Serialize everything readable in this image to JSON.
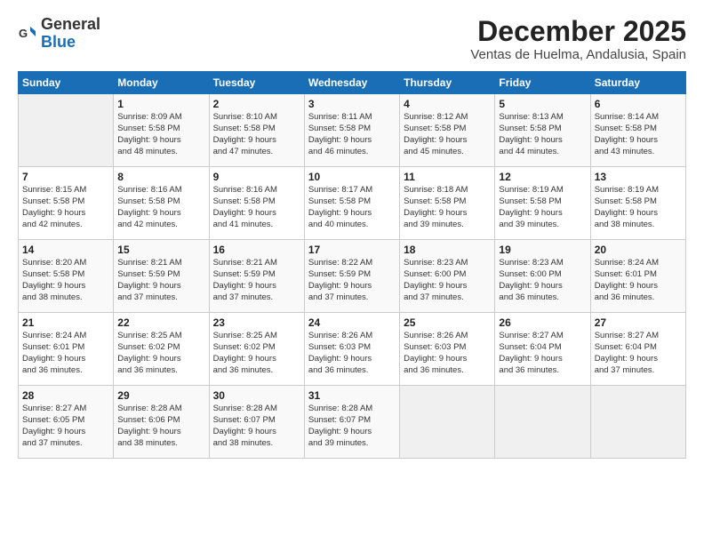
{
  "header": {
    "logo_general": "General",
    "logo_blue": "Blue",
    "month_title": "December 2025",
    "location": "Ventas de Huelma, Andalusia, Spain"
  },
  "days_of_week": [
    "Sunday",
    "Monday",
    "Tuesday",
    "Wednesday",
    "Thursday",
    "Friday",
    "Saturday"
  ],
  "weeks": [
    [
      {
        "num": "",
        "detail": ""
      },
      {
        "num": "1",
        "detail": "Sunrise: 8:09 AM\nSunset: 5:58 PM\nDaylight: 9 hours\nand 48 minutes."
      },
      {
        "num": "2",
        "detail": "Sunrise: 8:10 AM\nSunset: 5:58 PM\nDaylight: 9 hours\nand 47 minutes."
      },
      {
        "num": "3",
        "detail": "Sunrise: 8:11 AM\nSunset: 5:58 PM\nDaylight: 9 hours\nand 46 minutes."
      },
      {
        "num": "4",
        "detail": "Sunrise: 8:12 AM\nSunset: 5:58 PM\nDaylight: 9 hours\nand 45 minutes."
      },
      {
        "num": "5",
        "detail": "Sunrise: 8:13 AM\nSunset: 5:58 PM\nDaylight: 9 hours\nand 44 minutes."
      },
      {
        "num": "6",
        "detail": "Sunrise: 8:14 AM\nSunset: 5:58 PM\nDaylight: 9 hours\nand 43 minutes."
      }
    ],
    [
      {
        "num": "7",
        "detail": "Sunrise: 8:15 AM\nSunset: 5:58 PM\nDaylight: 9 hours\nand 42 minutes."
      },
      {
        "num": "8",
        "detail": "Sunrise: 8:16 AM\nSunset: 5:58 PM\nDaylight: 9 hours\nand 42 minutes."
      },
      {
        "num": "9",
        "detail": "Sunrise: 8:16 AM\nSunset: 5:58 PM\nDaylight: 9 hours\nand 41 minutes."
      },
      {
        "num": "10",
        "detail": "Sunrise: 8:17 AM\nSunset: 5:58 PM\nDaylight: 9 hours\nand 40 minutes."
      },
      {
        "num": "11",
        "detail": "Sunrise: 8:18 AM\nSunset: 5:58 PM\nDaylight: 9 hours\nand 39 minutes."
      },
      {
        "num": "12",
        "detail": "Sunrise: 8:19 AM\nSunset: 5:58 PM\nDaylight: 9 hours\nand 39 minutes."
      },
      {
        "num": "13",
        "detail": "Sunrise: 8:19 AM\nSunset: 5:58 PM\nDaylight: 9 hours\nand 38 minutes."
      }
    ],
    [
      {
        "num": "14",
        "detail": "Sunrise: 8:20 AM\nSunset: 5:58 PM\nDaylight: 9 hours\nand 38 minutes."
      },
      {
        "num": "15",
        "detail": "Sunrise: 8:21 AM\nSunset: 5:59 PM\nDaylight: 9 hours\nand 37 minutes."
      },
      {
        "num": "16",
        "detail": "Sunrise: 8:21 AM\nSunset: 5:59 PM\nDaylight: 9 hours\nand 37 minutes."
      },
      {
        "num": "17",
        "detail": "Sunrise: 8:22 AM\nSunset: 5:59 PM\nDaylight: 9 hours\nand 37 minutes."
      },
      {
        "num": "18",
        "detail": "Sunrise: 8:23 AM\nSunset: 6:00 PM\nDaylight: 9 hours\nand 37 minutes."
      },
      {
        "num": "19",
        "detail": "Sunrise: 8:23 AM\nSunset: 6:00 PM\nDaylight: 9 hours\nand 36 minutes."
      },
      {
        "num": "20",
        "detail": "Sunrise: 8:24 AM\nSunset: 6:01 PM\nDaylight: 9 hours\nand 36 minutes."
      }
    ],
    [
      {
        "num": "21",
        "detail": "Sunrise: 8:24 AM\nSunset: 6:01 PM\nDaylight: 9 hours\nand 36 minutes."
      },
      {
        "num": "22",
        "detail": "Sunrise: 8:25 AM\nSunset: 6:02 PM\nDaylight: 9 hours\nand 36 minutes."
      },
      {
        "num": "23",
        "detail": "Sunrise: 8:25 AM\nSunset: 6:02 PM\nDaylight: 9 hours\nand 36 minutes."
      },
      {
        "num": "24",
        "detail": "Sunrise: 8:26 AM\nSunset: 6:03 PM\nDaylight: 9 hours\nand 36 minutes."
      },
      {
        "num": "25",
        "detail": "Sunrise: 8:26 AM\nSunset: 6:03 PM\nDaylight: 9 hours\nand 36 minutes."
      },
      {
        "num": "26",
        "detail": "Sunrise: 8:27 AM\nSunset: 6:04 PM\nDaylight: 9 hours\nand 36 minutes."
      },
      {
        "num": "27",
        "detail": "Sunrise: 8:27 AM\nSunset: 6:04 PM\nDaylight: 9 hours\nand 37 minutes."
      }
    ],
    [
      {
        "num": "28",
        "detail": "Sunrise: 8:27 AM\nSunset: 6:05 PM\nDaylight: 9 hours\nand 37 minutes."
      },
      {
        "num": "29",
        "detail": "Sunrise: 8:28 AM\nSunset: 6:06 PM\nDaylight: 9 hours\nand 38 minutes."
      },
      {
        "num": "30",
        "detail": "Sunrise: 8:28 AM\nSunset: 6:07 PM\nDaylight: 9 hours\nand 38 minutes."
      },
      {
        "num": "31",
        "detail": "Sunrise: 8:28 AM\nSunset: 6:07 PM\nDaylight: 9 hours\nand 39 minutes."
      },
      {
        "num": "",
        "detail": ""
      },
      {
        "num": "",
        "detail": ""
      },
      {
        "num": "",
        "detail": ""
      }
    ]
  ]
}
